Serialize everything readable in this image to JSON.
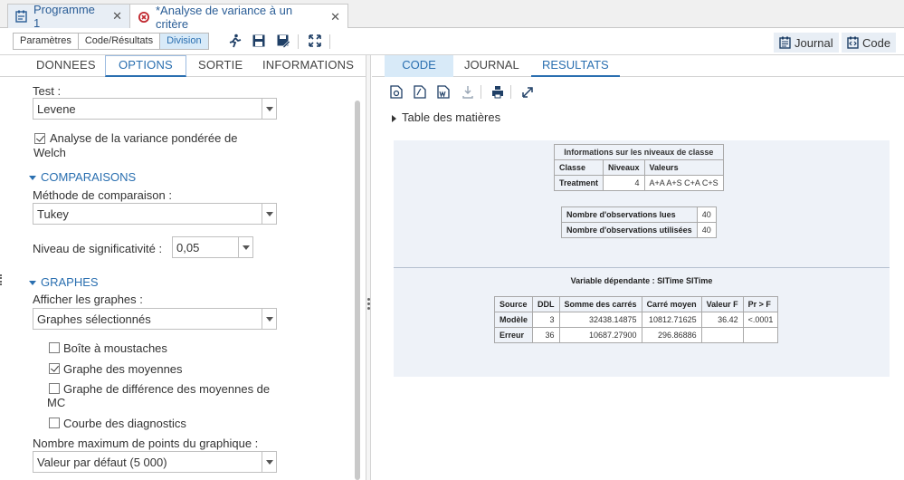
{
  "tabs": [
    {
      "label": "Programme 1",
      "close": "✕"
    },
    {
      "label": "*Analyse de variance à un critère",
      "close": "✕"
    }
  ],
  "toolbar": {
    "segments": [
      "Paramètres",
      "Code/Résultats",
      "Division"
    ],
    "journal_label": "Journal",
    "code_label": "Code"
  },
  "left_tabs": [
    "DONNEES",
    "OPTIONS",
    "SORTIE",
    "INFORMATIONS"
  ],
  "options": {
    "test_label": "Test :",
    "test_value": "Levene",
    "welch_label_line1": "Analyse de la variance pondérée de",
    "welch_label_line2": "Welch",
    "comparaisons_header": "COMPARAISONS",
    "methode_label": "Méthode de comparaison :",
    "methode_value": "Tukey",
    "niveau_label": "Niveau de significativité :",
    "niveau_value": "0,05",
    "graphes_header": "GRAPHES",
    "afficher_label": "Afficher les graphes :",
    "afficher_value": "Graphes sélectionnés",
    "boite_label": "Boîte à moustaches",
    "moyennes_label": "Graphe des moyennes",
    "diff_label_line1": "Graphe de différence des moyennes de",
    "diff_label_line2": "MC",
    "diag_label": "Courbe des diagnostics",
    "max_points_label": "Nombre maximum de points du graphique :",
    "max_points_value": "Valeur par défaut (5 000)"
  },
  "right_tabs": [
    "CODE",
    "JOURNAL",
    "RESULTATS"
  ],
  "toc_label": "Table des matières",
  "class_info": {
    "caption": "Informations sur les niveaux de classe",
    "headers": [
      "Classe",
      "Niveaux",
      "Valeurs"
    ],
    "row": [
      "Treatment",
      "4",
      "A+A A+S C+A C+S"
    ]
  },
  "obs": {
    "rows": [
      [
        "Nombre d'observations lues",
        "40"
      ],
      [
        "Nombre d'observations utilisées",
        "40"
      ]
    ]
  },
  "anova": {
    "title": "Variable dépendante : SITime SITime",
    "headers": [
      "Source",
      "DDL",
      "Somme des carrés",
      "Carré moyen",
      "Valeur F",
      "Pr > F"
    ],
    "rows": [
      [
        "Modèle",
        "3",
        "32438.14875",
        "10812.71625",
        "36.42",
        "<.0001"
      ],
      [
        "Erreur",
        "36",
        "10687.27900",
        "296.86886",
        "",
        ""
      ]
    ]
  }
}
